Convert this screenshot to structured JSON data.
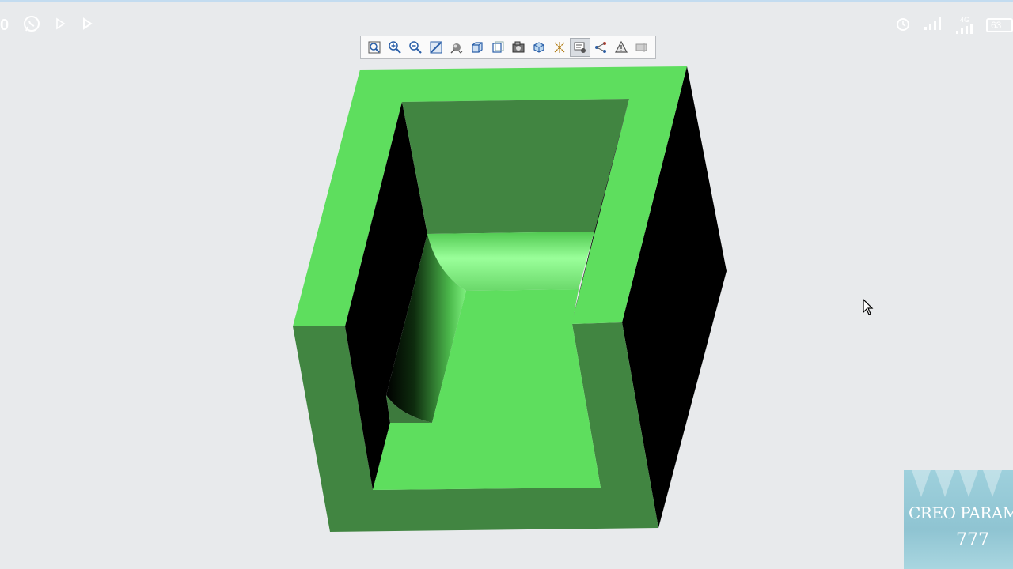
{
  "status_bar": {
    "left_number": "0",
    "battery_level": "63",
    "network_label": "4G"
  },
  "toolbar": {
    "buttons": [
      {
        "name": "refit",
        "icon": "refit-icon"
      },
      {
        "name": "zoom-in",
        "icon": "zoom-in-icon"
      },
      {
        "name": "zoom-out",
        "icon": "zoom-out-icon"
      },
      {
        "name": "repaint",
        "icon": "repaint-icon"
      },
      {
        "name": "perspective",
        "icon": "perspective-icon"
      },
      {
        "name": "display-style",
        "icon": "display-style-icon"
      },
      {
        "name": "saved-orientations",
        "icon": "saved-orientations-icon"
      },
      {
        "name": "view-manager",
        "icon": "view-manager-icon"
      },
      {
        "name": "section",
        "icon": "section-icon"
      },
      {
        "name": "datum-display",
        "icon": "datum-display-icon"
      },
      {
        "name": "annotation-display",
        "icon": "annotation-display-icon",
        "active": true
      },
      {
        "name": "spin-center",
        "icon": "spin-center-icon"
      },
      {
        "name": "appearance",
        "icon": "appearance-icon"
      },
      {
        "name": "more",
        "icon": "more-icon"
      }
    ]
  },
  "model": {
    "colors": {
      "light_green": "#5ede5e",
      "dark_green": "#418541",
      "black": "#000000",
      "highlight_green": "#9aff9a"
    }
  },
  "watermark": {
    "title": "CREO PARAMET",
    "number": "777"
  }
}
